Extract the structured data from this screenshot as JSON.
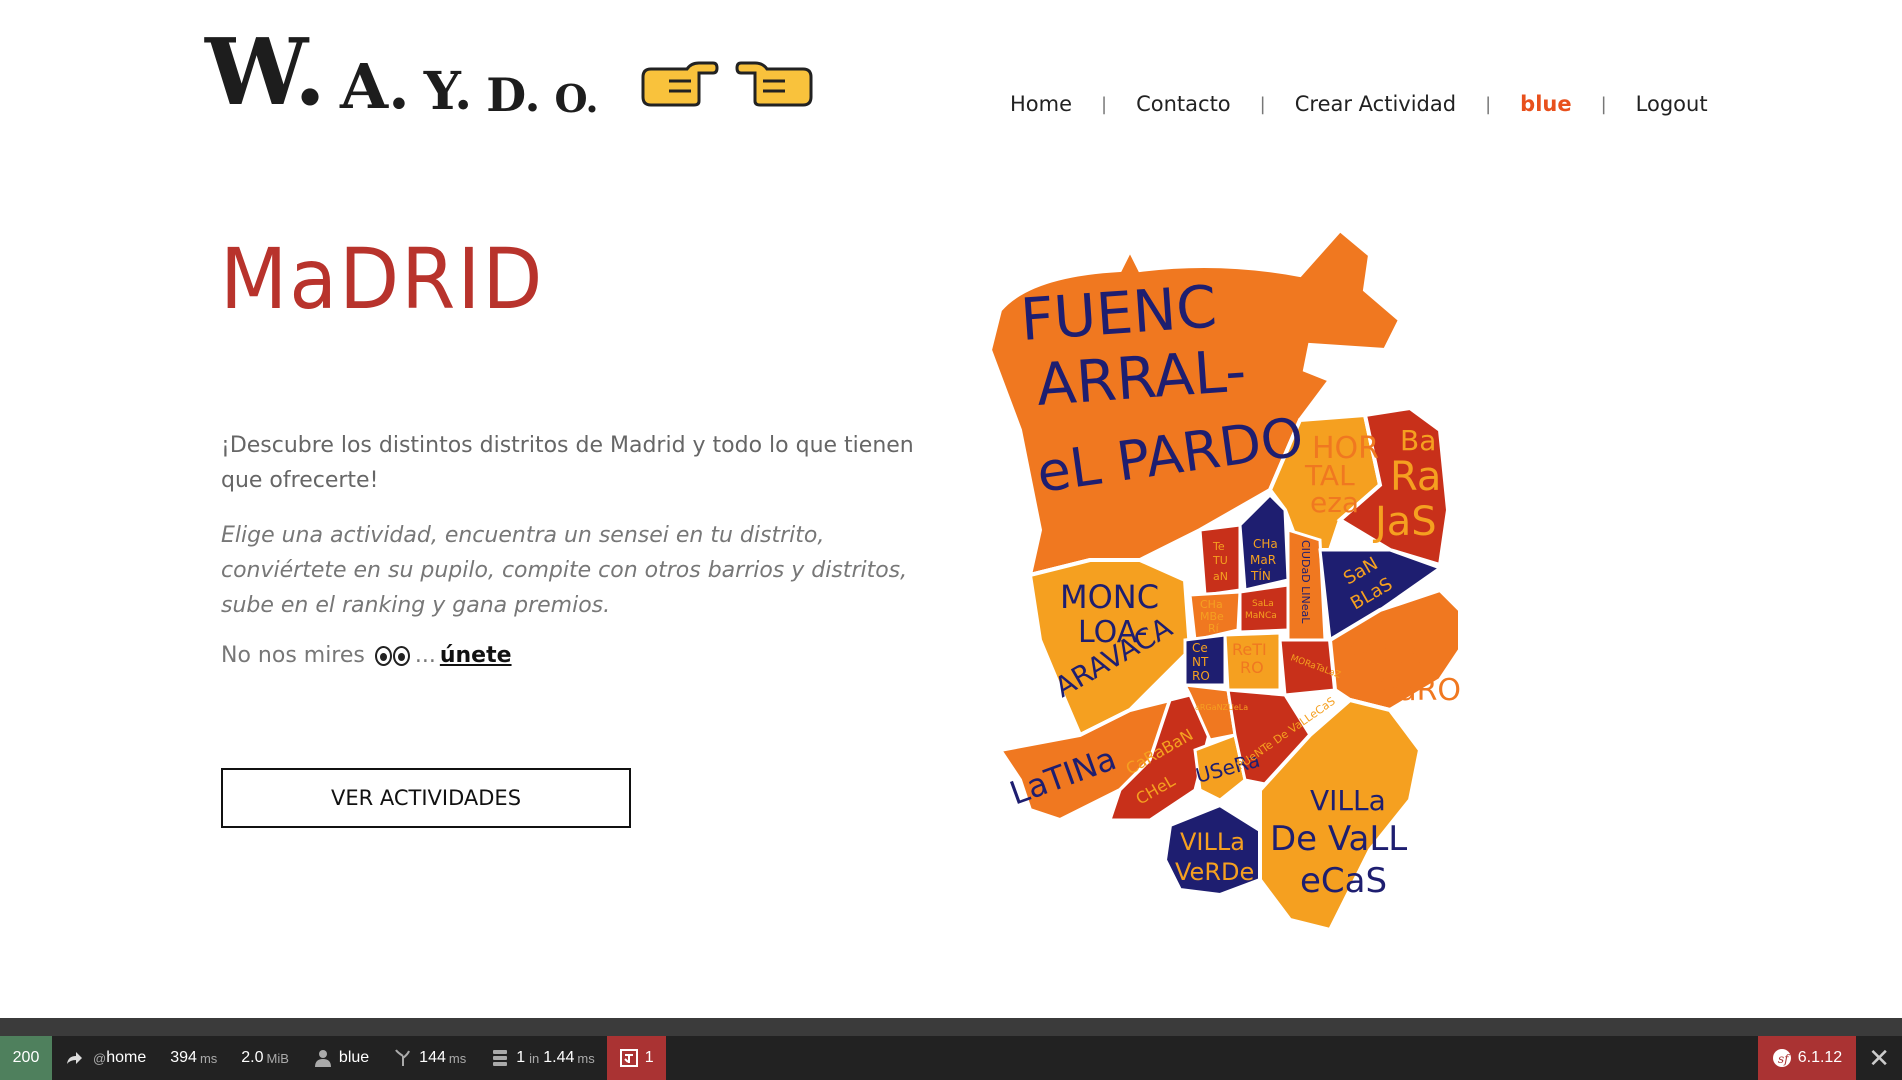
{
  "logo": {
    "letters": [
      "W.",
      "A.",
      "Y.",
      "D.",
      "O."
    ]
  },
  "nav": {
    "items": [
      {
        "label": "Home"
      },
      {
        "label": "Contacto"
      },
      {
        "label": "Crear Actividad"
      },
      {
        "label": "blue"
      },
      {
        "label": "Logout"
      }
    ],
    "separator": "|",
    "active_color": "#e8501c"
  },
  "hero": {
    "title": "MaDRID",
    "intro": "¡Descubre los distintos distritos de Madrid y todo lo que tienen que ofrecerte!",
    "intro_italic": "Elige una actividad, encuentra un sensei en tu distrito, conviértete en su pupilo, compite con otros barrios y distritos, sube en el ranking y gana premios.",
    "cta_prefix": "No nos mires",
    "cta_ellipsis": "...",
    "cta_link": "únete",
    "button": "VER ACTIVIDADES",
    "title_color": "#b8332c"
  },
  "map": {
    "districts": [
      {
        "label": "FUENC"
      },
      {
        "label": "ARRAL-"
      },
      {
        "label": "eL PARDO"
      },
      {
        "label": "HOR"
      },
      {
        "label": "TAL"
      },
      {
        "label": "eza"
      },
      {
        "label": "Ba"
      },
      {
        "label": "Ra"
      },
      {
        "label": "JaS"
      },
      {
        "label": "MONC"
      },
      {
        "label": "LOA-"
      },
      {
        "label": "ARAVACA"
      },
      {
        "label": "Te"
      },
      {
        "label": "TU"
      },
      {
        "label": "aN"
      },
      {
        "label": "CHa"
      },
      {
        "label": "MaR"
      },
      {
        "label": "TÍN"
      },
      {
        "label": "CHa"
      },
      {
        "label": "MBe"
      },
      {
        "label": "Rí"
      },
      {
        "label": "SaLa"
      },
      {
        "label": "MaNCa"
      },
      {
        "label": "CIUDaD LINeaL"
      },
      {
        "label": "SaN"
      },
      {
        "label": "BLaS"
      },
      {
        "label": "Ce"
      },
      {
        "label": "NT"
      },
      {
        "label": "RO"
      },
      {
        "label": "ReTI"
      },
      {
        "label": "RO"
      },
      {
        "label": "MORaTaLaZ"
      },
      {
        "label": "VICÁL"
      },
      {
        "label": "VaRO"
      },
      {
        "label": "LaTINa"
      },
      {
        "label": "CaRaBaN"
      },
      {
        "label": "CHeL"
      },
      {
        "label": "aRGaNZUeLa"
      },
      {
        "label": "USeRa"
      },
      {
        "label": "PUeNTe De VaLLeCaS"
      },
      {
        "label": "VILLa"
      },
      {
        "label": "VeRDe"
      },
      {
        "label": "VILLa"
      },
      {
        "label": "De VaLL"
      },
      {
        "label": "eCaS"
      }
    ],
    "colors": {
      "orange": "#f07820",
      "light_orange": "#f5a020",
      "red": "#c8301a",
      "navy": "#1e1e70"
    }
  },
  "debug_toolbar": {
    "status": "200",
    "route_prefix": "@",
    "route": "home",
    "time_value": "394",
    "time_unit": "ms",
    "memory_value": "2.0",
    "memory_unit": "MiB",
    "user": "blue",
    "perf_value": "144",
    "perf_unit": "ms",
    "db_queries": "1",
    "db_in": "in",
    "db_time": "1.44",
    "db_unit": "ms",
    "twig_count": "1",
    "version": "6.1.12",
    "close": "✕",
    "status_color": "#4f805d",
    "alert_color": "#a33"
  }
}
